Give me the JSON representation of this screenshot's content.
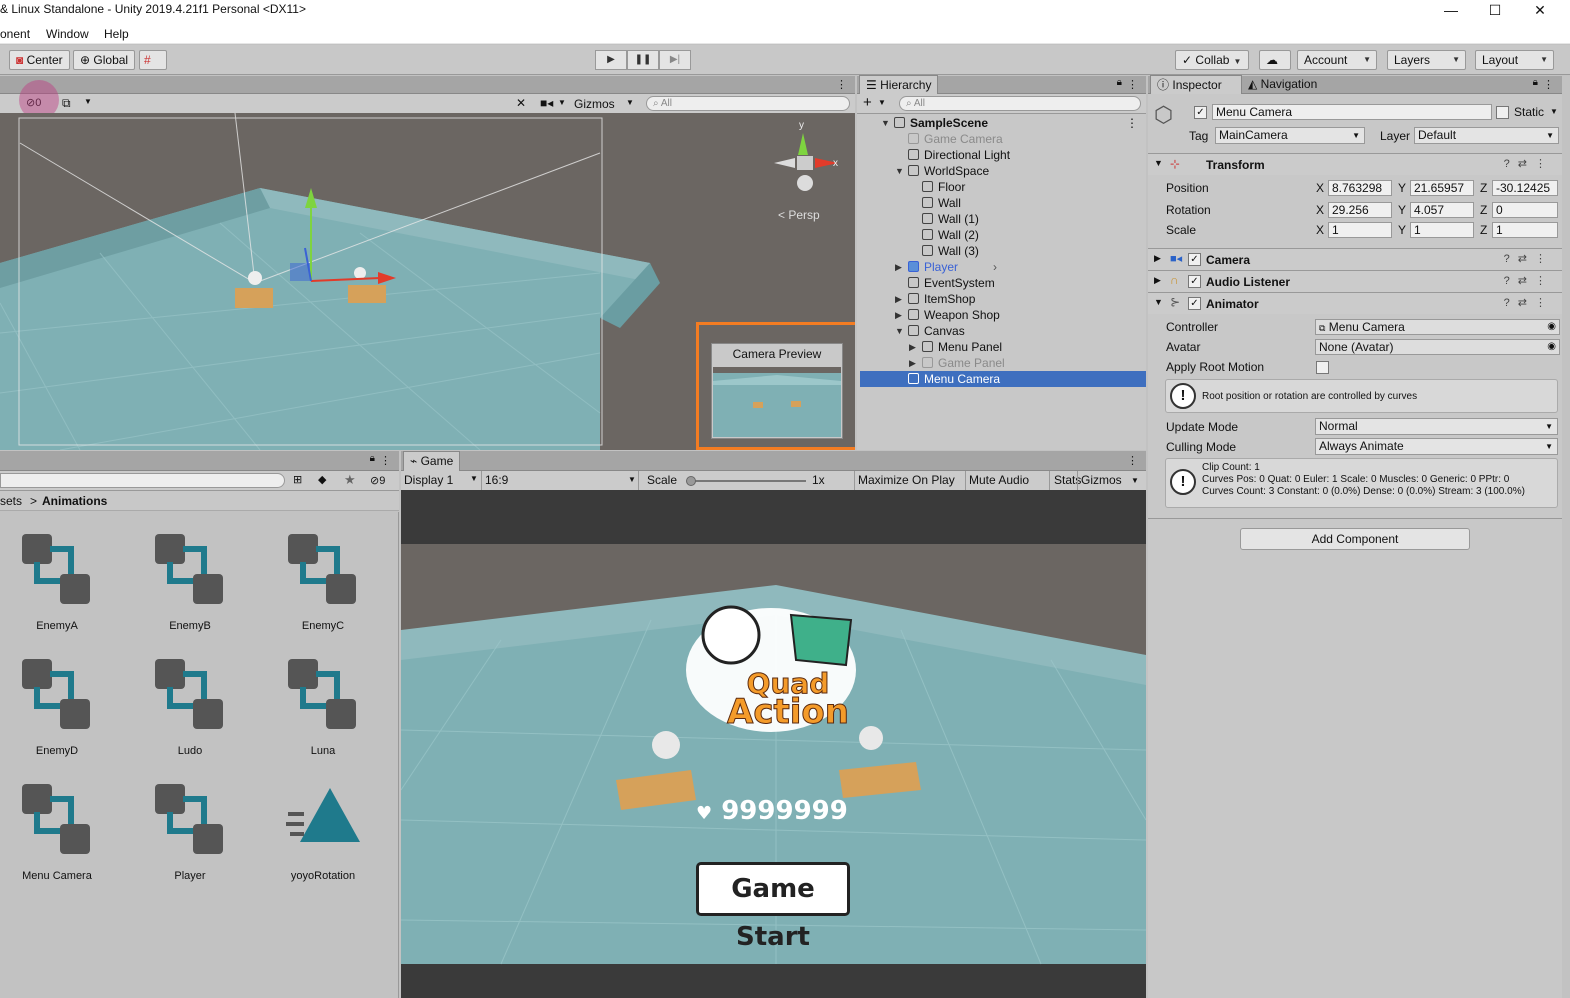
{
  "window": {
    "title": "& Linux Standalone - Unity 2019.4.21f1 Personal <DX11>",
    "controls": [
      "—",
      "☐",
      "✕"
    ]
  },
  "menu": {
    "items": [
      "onent",
      "Window",
      "Help"
    ]
  },
  "toolbar": {
    "center_label": "Center",
    "global_label": "Global",
    "collab_label": "Collab",
    "account_label": "Account",
    "layers_label": "Layers",
    "layout_label": "Layout"
  },
  "scene": {
    "hidden_count": "0",
    "gizmos_label": "Gizmos",
    "search_placeholder": "All",
    "persp_label": "< Persp",
    "camera_preview_title": "Camera Preview",
    "gizmo_axes": {
      "y": "y",
      "x": "x"
    }
  },
  "hierarchy": {
    "tab_label": "Hierarchy",
    "search_placeholder": "All",
    "items": [
      {
        "label": "SampleScene",
        "depth": 0,
        "expand": "▼",
        "kind": "scene"
      },
      {
        "label": "Game Camera",
        "depth": 1,
        "expand": "",
        "kind": "disabled"
      },
      {
        "label": "Directional Light",
        "depth": 1,
        "expand": "",
        "kind": "normal"
      },
      {
        "label": "WorldSpace",
        "depth": 1,
        "expand": "▼",
        "kind": "normal"
      },
      {
        "label": "Floor",
        "depth": 2,
        "expand": "",
        "kind": "normal"
      },
      {
        "label": "Wall",
        "depth": 2,
        "expand": "",
        "kind": "normal"
      },
      {
        "label": "Wall (1)",
        "depth": 2,
        "expand": "",
        "kind": "normal"
      },
      {
        "label": "Wall (2)",
        "depth": 2,
        "expand": "",
        "kind": "normal"
      },
      {
        "label": "Wall (3)",
        "depth": 2,
        "expand": "",
        "kind": "normal"
      },
      {
        "label": "Player",
        "depth": 1,
        "expand": "▶",
        "kind": "prefab"
      },
      {
        "label": "EventSystem",
        "depth": 1,
        "expand": "",
        "kind": "normal"
      },
      {
        "label": "ItemShop",
        "depth": 1,
        "expand": "▶",
        "kind": "normal"
      },
      {
        "label": "Weapon Shop",
        "depth": 1,
        "expand": "▶",
        "kind": "normal"
      },
      {
        "label": "Canvas",
        "depth": 1,
        "expand": "▼",
        "kind": "normal"
      },
      {
        "label": "Menu Panel",
        "depth": 2,
        "expand": "▶",
        "kind": "normal"
      },
      {
        "label": "Game Panel",
        "depth": 2,
        "expand": "▶",
        "kind": "disabled"
      },
      {
        "label": "Menu Camera",
        "depth": 1,
        "expand": "",
        "kind": "selected"
      }
    ]
  },
  "inspector": {
    "tab_label": "Inspector",
    "nav_tab_label": "Navigation",
    "object_name": "Menu Camera",
    "static_label": "Static",
    "tag_label": "Tag",
    "tag_value": "MainCamera",
    "layer_label": "Layer",
    "layer_value": "Default",
    "transform": {
      "title": "Transform",
      "position_label": "Position",
      "rotation_label": "Rotation",
      "scale_label": "Scale",
      "position": {
        "x": "8.763298",
        "y": "21.65957",
        "z": "-30.12425"
      },
      "rotation": {
        "x": "29.256",
        "y": "4.057",
        "z": "0"
      },
      "scale": {
        "x": "1",
        "y": "1",
        "z": "1"
      },
      "axis": {
        "x": "X",
        "y": "Y",
        "z": "Z"
      }
    },
    "camera_title": "Camera",
    "audio_listener_title": "Audio Listener",
    "animator": {
      "title": "Animator",
      "controller_label": "Controller",
      "controller_value": "Menu Camera",
      "avatar_label": "Avatar",
      "avatar_value": "None (Avatar)",
      "apply_root_motion_label": "Apply Root Motion",
      "root_note": "Root position or rotation are controlled by curves",
      "update_mode_label": "Update Mode",
      "update_mode_value": "Normal",
      "culling_mode_label": "Culling Mode",
      "culling_mode_value": "Always Animate",
      "clip_info_1": "Clip Count: 1",
      "clip_info_2": "Curves Pos: 0 Quat: 0 Euler: 1 Scale: 0 Muscles: 0 Generic: 0 PPtr: 0",
      "clip_info_3": "Curves Count: 3 Constant: 0 (0.0%) Dense: 0 (0.0%) Stream: 3 (100.0%)"
    },
    "add_component_label": "Add Component"
  },
  "project": {
    "breadcrumb_prev": "sets",
    "breadcrumb_sep": ">",
    "breadcrumb_current": "Animations",
    "hidden_count": "9",
    "assets": [
      {
        "name": "EnemyA",
        "type": "controller"
      },
      {
        "name": "EnemyB",
        "type": "controller"
      },
      {
        "name": "EnemyC",
        "type": "controller"
      },
      {
        "name": "EnemyD",
        "type": "controller"
      },
      {
        "name": "Ludo",
        "type": "controller"
      },
      {
        "name": "Luna",
        "type": "controller"
      },
      {
        "name": "Menu Camera",
        "type": "controller"
      },
      {
        "name": "Player",
        "type": "controller"
      },
      {
        "name": "yoyoRotation",
        "type": "clip"
      }
    ]
  },
  "game": {
    "tab_label": "Game",
    "display_label": "Display 1",
    "aspect_label": "16:9",
    "scale_label": "Scale",
    "scale_value": "1x",
    "maximize_label": "Maximize On Play",
    "mute_label": "Mute Audio",
    "stats_label": "Stats",
    "gizmos_label": "Gizmos",
    "logo_line1": "Quad",
    "logo_line2": "Action",
    "coins": "9999999",
    "start_button": "Game Start"
  },
  "colors": {
    "selection": "#3e6fbf",
    "highlight_orange": "#f37c22",
    "floor": "#7fb0b4",
    "controller_teal": "#1f7a8c"
  }
}
